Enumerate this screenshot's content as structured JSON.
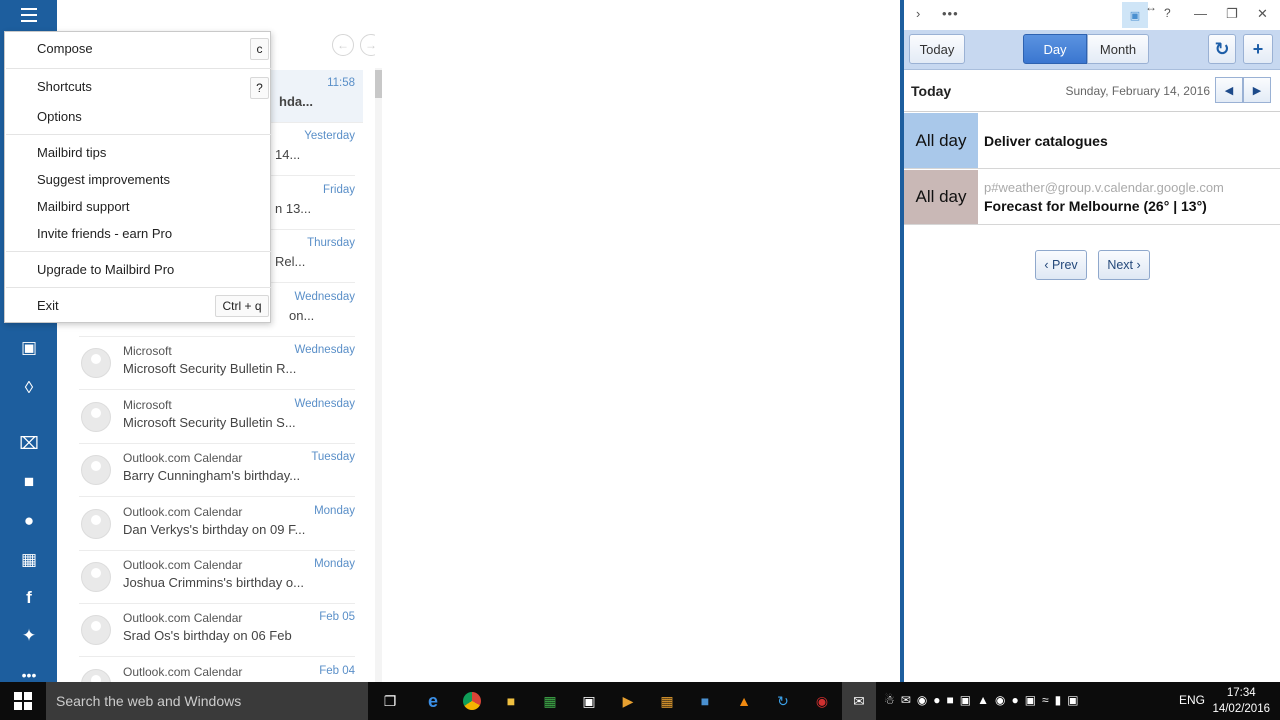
{
  "menu": {
    "items": [
      {
        "label": "Compose",
        "shortcut": "c"
      },
      {
        "label": "Shortcuts",
        "shortcut": "?"
      },
      {
        "label": "Options"
      },
      {
        "label": "Mailbird tips"
      },
      {
        "label": "Suggest improvements"
      },
      {
        "label": "Mailbird support"
      },
      {
        "label": "Invite friends - earn Pro"
      },
      {
        "label": "Upgrade to Mailbird Pro"
      },
      {
        "label": "Exit",
        "shortcut": "Ctrl + q"
      }
    ]
  },
  "messages": [
    {
      "sender": "",
      "subject": "hda...",
      "date": "11:58"
    },
    {
      "sender": "",
      "subject": "14...",
      "date": "Yesterday"
    },
    {
      "sender": "",
      "subject": "n 13...",
      "date": "Friday"
    },
    {
      "sender": "",
      "subject": "Rel...",
      "date": "Thursday"
    },
    {
      "sender": "",
      "subject": "on...",
      "date": "Wednesday"
    },
    {
      "sender": "Microsoft",
      "subject": "Microsoft Security Bulletin R...",
      "date": "Wednesday"
    },
    {
      "sender": "Microsoft",
      "subject": "Microsoft Security Bulletin S...",
      "date": "Wednesday"
    },
    {
      "sender": "Outlook.com Calendar",
      "subject": "Barry Cunningham's birthday...",
      "date": "Tuesday"
    },
    {
      "sender": "Outlook.com Calendar",
      "subject": "Dan Verkys's birthday on 09 F...",
      "date": "Monday"
    },
    {
      "sender": "Outlook.com Calendar",
      "subject": "Joshua Crimmins's birthday o...",
      "date": "Monday"
    },
    {
      "sender": "Outlook.com Calendar",
      "subject": "Srad Os's birthday on 06 Feb",
      "date": "Feb 05"
    },
    {
      "sender": "Outlook.com Calendar",
      "subject": "",
      "date": "Feb 04"
    }
  ],
  "calendar": {
    "toolbar": {
      "today": "Today",
      "day": "Day",
      "month": "Month"
    },
    "header": {
      "label": "Today",
      "date": "Sunday, February 14, 2016"
    },
    "events": [
      {
        "time": "All day",
        "title": "Deliver catalogues",
        "source": "",
        "color": "#a9c8ea"
      },
      {
        "time": "All day",
        "title": "Forecast for Melbourne (26° | 13°)",
        "source": "p#weather@group.v.calendar.google.com",
        "color": "#c9b8b6"
      }
    ],
    "pager": {
      "prev": "‹ Prev",
      "next": "Next ›"
    }
  },
  "taskbar": {
    "search_placeholder": "Search the web and Windows",
    "language": "ENG",
    "time": "17:34",
    "date": "14/02/2016"
  },
  "colors": {
    "accent": "#1d5e9e",
    "date_blue": "#5a8fc8",
    "toolbar": "#c7d8f0"
  }
}
